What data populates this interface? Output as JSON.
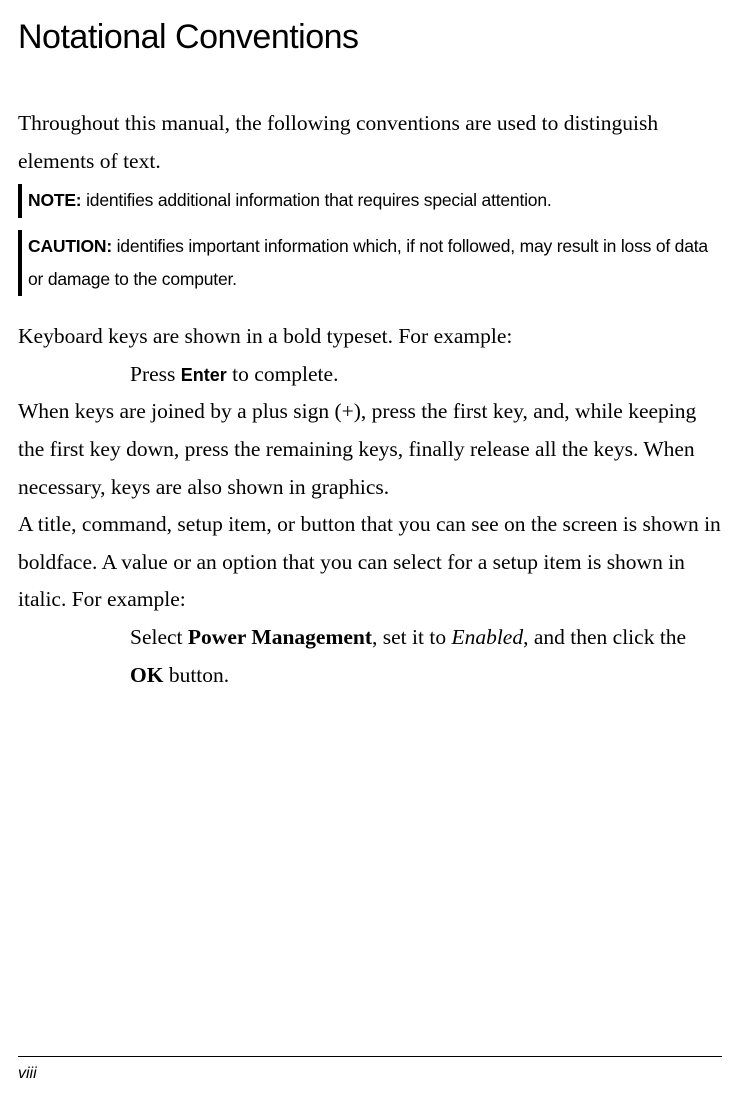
{
  "title": "Notational Conventions",
  "intro": "Throughout this manual, the following conventions are used to distinguish elements of text.",
  "note": {
    "label": "NOTE:",
    "text": " identifies additional information that requires special attention."
  },
  "caution": {
    "label": "CAUTION:",
    "text": " identifies important information which, if not followed, may result in loss of data or damage to the computer."
  },
  "keys_intro": "Keyboard keys are shown in a bold typeset. For example:",
  "example_enter": {
    "pre": "Press ",
    "key": "Enter",
    "post": " to complete."
  },
  "plus_sign_text": "When keys are joined by a plus sign (+), press the first key, and, while keeping the first key down, press the remaining keys, finally release all the keys. When necessary, keys are also shown in graphics.",
  "screen_text": "A title, command, setup item, or button that you can see on the screen is shown in boldface. A value or an option that you can select for a setup item is shown in italic. For example:",
  "example_select": {
    "t1": "Select ",
    "bold1": "Power Management",
    "t2": ", set it to ",
    "italic1": "Enabled",
    "t3": ", and then click the ",
    "bold2": "OK",
    "t4": " button."
  },
  "page_number": "viii"
}
